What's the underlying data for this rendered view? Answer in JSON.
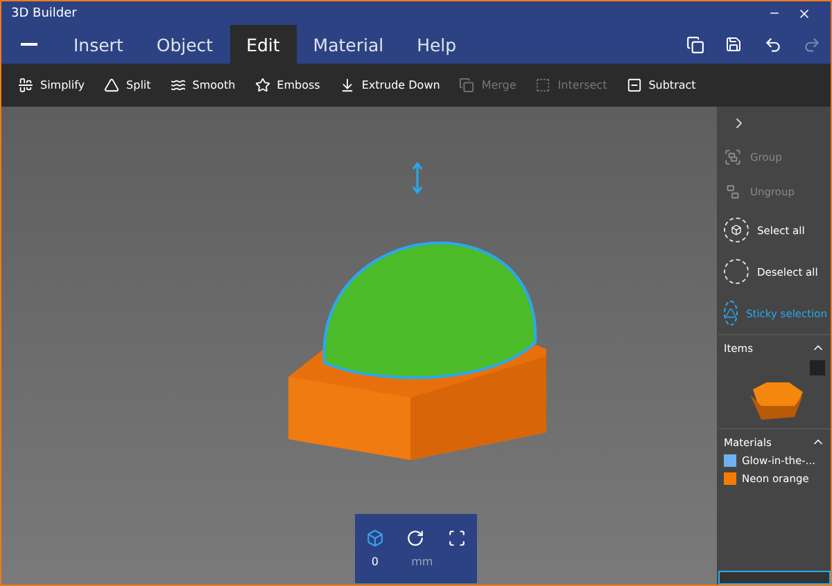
{
  "window": {
    "title": "3D Builder"
  },
  "menu": [
    {
      "label": "Insert",
      "selected": false
    },
    {
      "label": "Object",
      "selected": false
    },
    {
      "label": "Edit",
      "selected": true
    },
    {
      "label": "Material",
      "selected": false
    },
    {
      "label": "Help",
      "selected": false
    }
  ],
  "toolbar": [
    {
      "label": "Simplify",
      "kind": "simplify",
      "disabled": false
    },
    {
      "label": "Split",
      "kind": "split",
      "disabled": false
    },
    {
      "label": "Smooth",
      "kind": "smooth",
      "disabled": false
    },
    {
      "label": "Emboss",
      "kind": "emboss",
      "disabled": false
    },
    {
      "label": "Extrude Down",
      "kind": "extrude",
      "disabled": false
    },
    {
      "label": "Merge",
      "kind": "merge",
      "disabled": true
    },
    {
      "label": "Intersect",
      "kind": "intersect",
      "disabled": true
    },
    {
      "label": "Subtract",
      "kind": "subtract",
      "disabled": false
    }
  ],
  "side_actions": [
    {
      "label": "Group",
      "kind": "group",
      "disabled": true,
      "selected": false
    },
    {
      "label": "Ungroup",
      "kind": "ungroup",
      "disabled": true,
      "selected": false
    },
    {
      "label": "Select all",
      "kind": "selectall",
      "disabled": false,
      "selected": false
    },
    {
      "label": "Deselect all",
      "kind": "deselect",
      "disabled": false,
      "selected": false
    },
    {
      "label": "Sticky selection",
      "kind": "sticky",
      "disabled": false,
      "selected": true
    }
  ],
  "items": {
    "title": "Items",
    "expanded": true
  },
  "materials": {
    "title": "Materials",
    "expanded": true,
    "entries": [
      {
        "name": "Glow-in-the-...",
        "color": "#6fb1ee"
      },
      {
        "name": "Neon orange",
        "color": "#f57c00"
      }
    ]
  },
  "transform": {
    "modes": [
      {
        "kind": "move",
        "selected": true
      },
      {
        "kind": "rotate",
        "selected": false
      },
      {
        "kind": "scale",
        "selected": false
      }
    ],
    "value": "0",
    "unit": "mm"
  }
}
